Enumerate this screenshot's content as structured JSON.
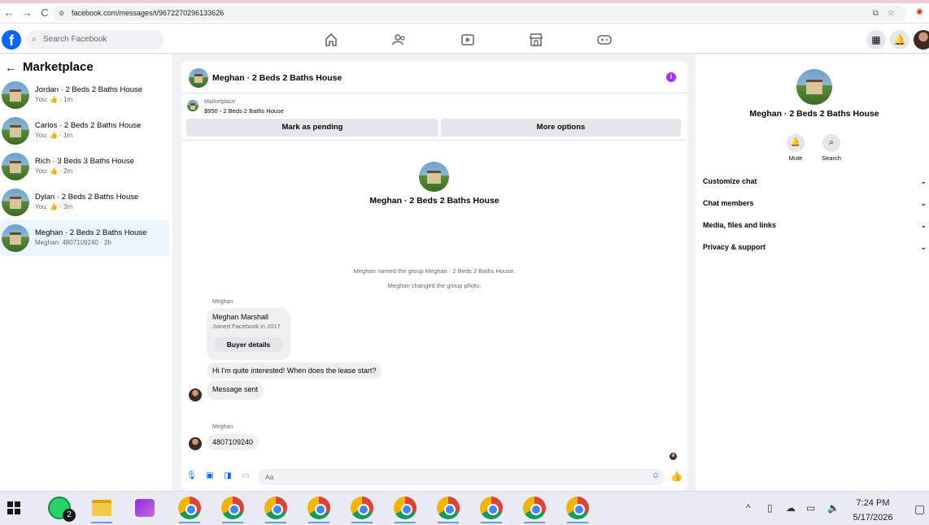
{
  "browser": {
    "url": "facebook.com/messages/t/9672270296133626",
    "nav_back": "←",
    "nav_forward": "→",
    "nav_reload": "C"
  },
  "header": {
    "logo": "f",
    "search_placeholder": "Search Facebook",
    "nav_icons": [
      "home-icon",
      "friends-icon",
      "video-icon",
      "marketplace-icon",
      "gaming-icon"
    ],
    "right_icons": [
      "apps-grid-icon",
      "notifications-bell-icon",
      "profile-avatar"
    ]
  },
  "left_panel": {
    "back_arrow": "←",
    "title": "Marketplace",
    "conversations": [
      {
        "title": "Jordan · 2 Beds 2 Baths House",
        "subtitle": "You: 👍 · 1m"
      },
      {
        "title": "Carlos · 2 Beds 2 Baths House",
        "subtitle": "You: 👍 · 1m"
      },
      {
        "title": "Rich · 3 Beds 3 Baths House",
        "subtitle": "You: 👍 · 2m"
      },
      {
        "title": "Dylan · 2 Beds 2 Baths House",
        "subtitle": "You: 👍 · 3m"
      },
      {
        "title": "Meghan · 2 Beds 2 Baths House",
        "subtitle": "Meghan: 4807109240 · 2h"
      }
    ]
  },
  "chat": {
    "title": "Meghan · 2 Beds 2 Baths House",
    "info_icon": "i",
    "listing_source": "Marketplace",
    "listing_text": "$950 - 2 Beds 2 Baths House",
    "mark_pending": "Mark as pending",
    "more_options": "More options",
    "big_title": "Meghan · 2 Beds 2 Baths House",
    "system_messages": [
      "Meghan named the group Meghan · 2 Beds 2 Baths House.",
      "Meghan changed the group photo."
    ],
    "sender_label_1": "Meghan",
    "buyer_name": "Meghan Marshall",
    "buyer_joined": "Joined Facebook in 2017",
    "buyer_details": "Buyer details",
    "message_1": "Hi I'm quite interested! When does the lease start?",
    "message_2": "Message sent",
    "sender_label_2": "Meghan",
    "message_3": "4807109240",
    "composer_placeholder": "Aa"
  },
  "right_panel": {
    "title": "Meghan · 2 Beds 2 Baths House",
    "mute": "Mute",
    "search": "Search",
    "sections": [
      "Customize chat",
      "Chat members",
      "Media, files and links",
      "Privacy & support"
    ]
  },
  "taskbar": {
    "whatsapp_badge": "2",
    "time": "7:24 PM",
    "date": "5/17/2026"
  },
  "colors": {
    "accent": "#0866ff",
    "info": "#a033ff",
    "active_conv": "#ebf5ff"
  }
}
